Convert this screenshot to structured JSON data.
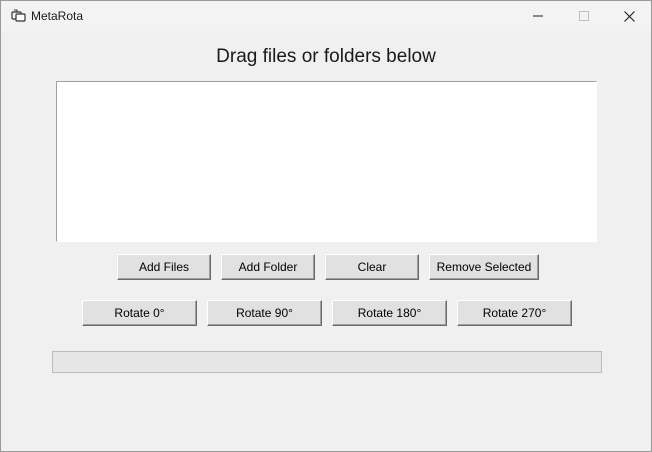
{
  "window": {
    "title": "MetaRota",
    "app_icon": "metarota-app-icon",
    "controls": {
      "minimize_icon": "minimize-icon",
      "maximize_icon": "maximize-icon",
      "close_icon": "close-icon"
    }
  },
  "main": {
    "heading": "Drag files or folders below",
    "file_list": {
      "items": []
    },
    "file_buttons": {
      "add_files": "Add Files",
      "add_folder": "Add Folder",
      "clear": "Clear",
      "remove_selected": "Remove Selected"
    },
    "rotate_buttons": {
      "rotate_0": "Rotate 0°",
      "rotate_90": "Rotate 90°",
      "rotate_180": "Rotate 180°",
      "rotate_270": "Rotate 270°"
    },
    "progress": {
      "value_percent": 0
    }
  }
}
